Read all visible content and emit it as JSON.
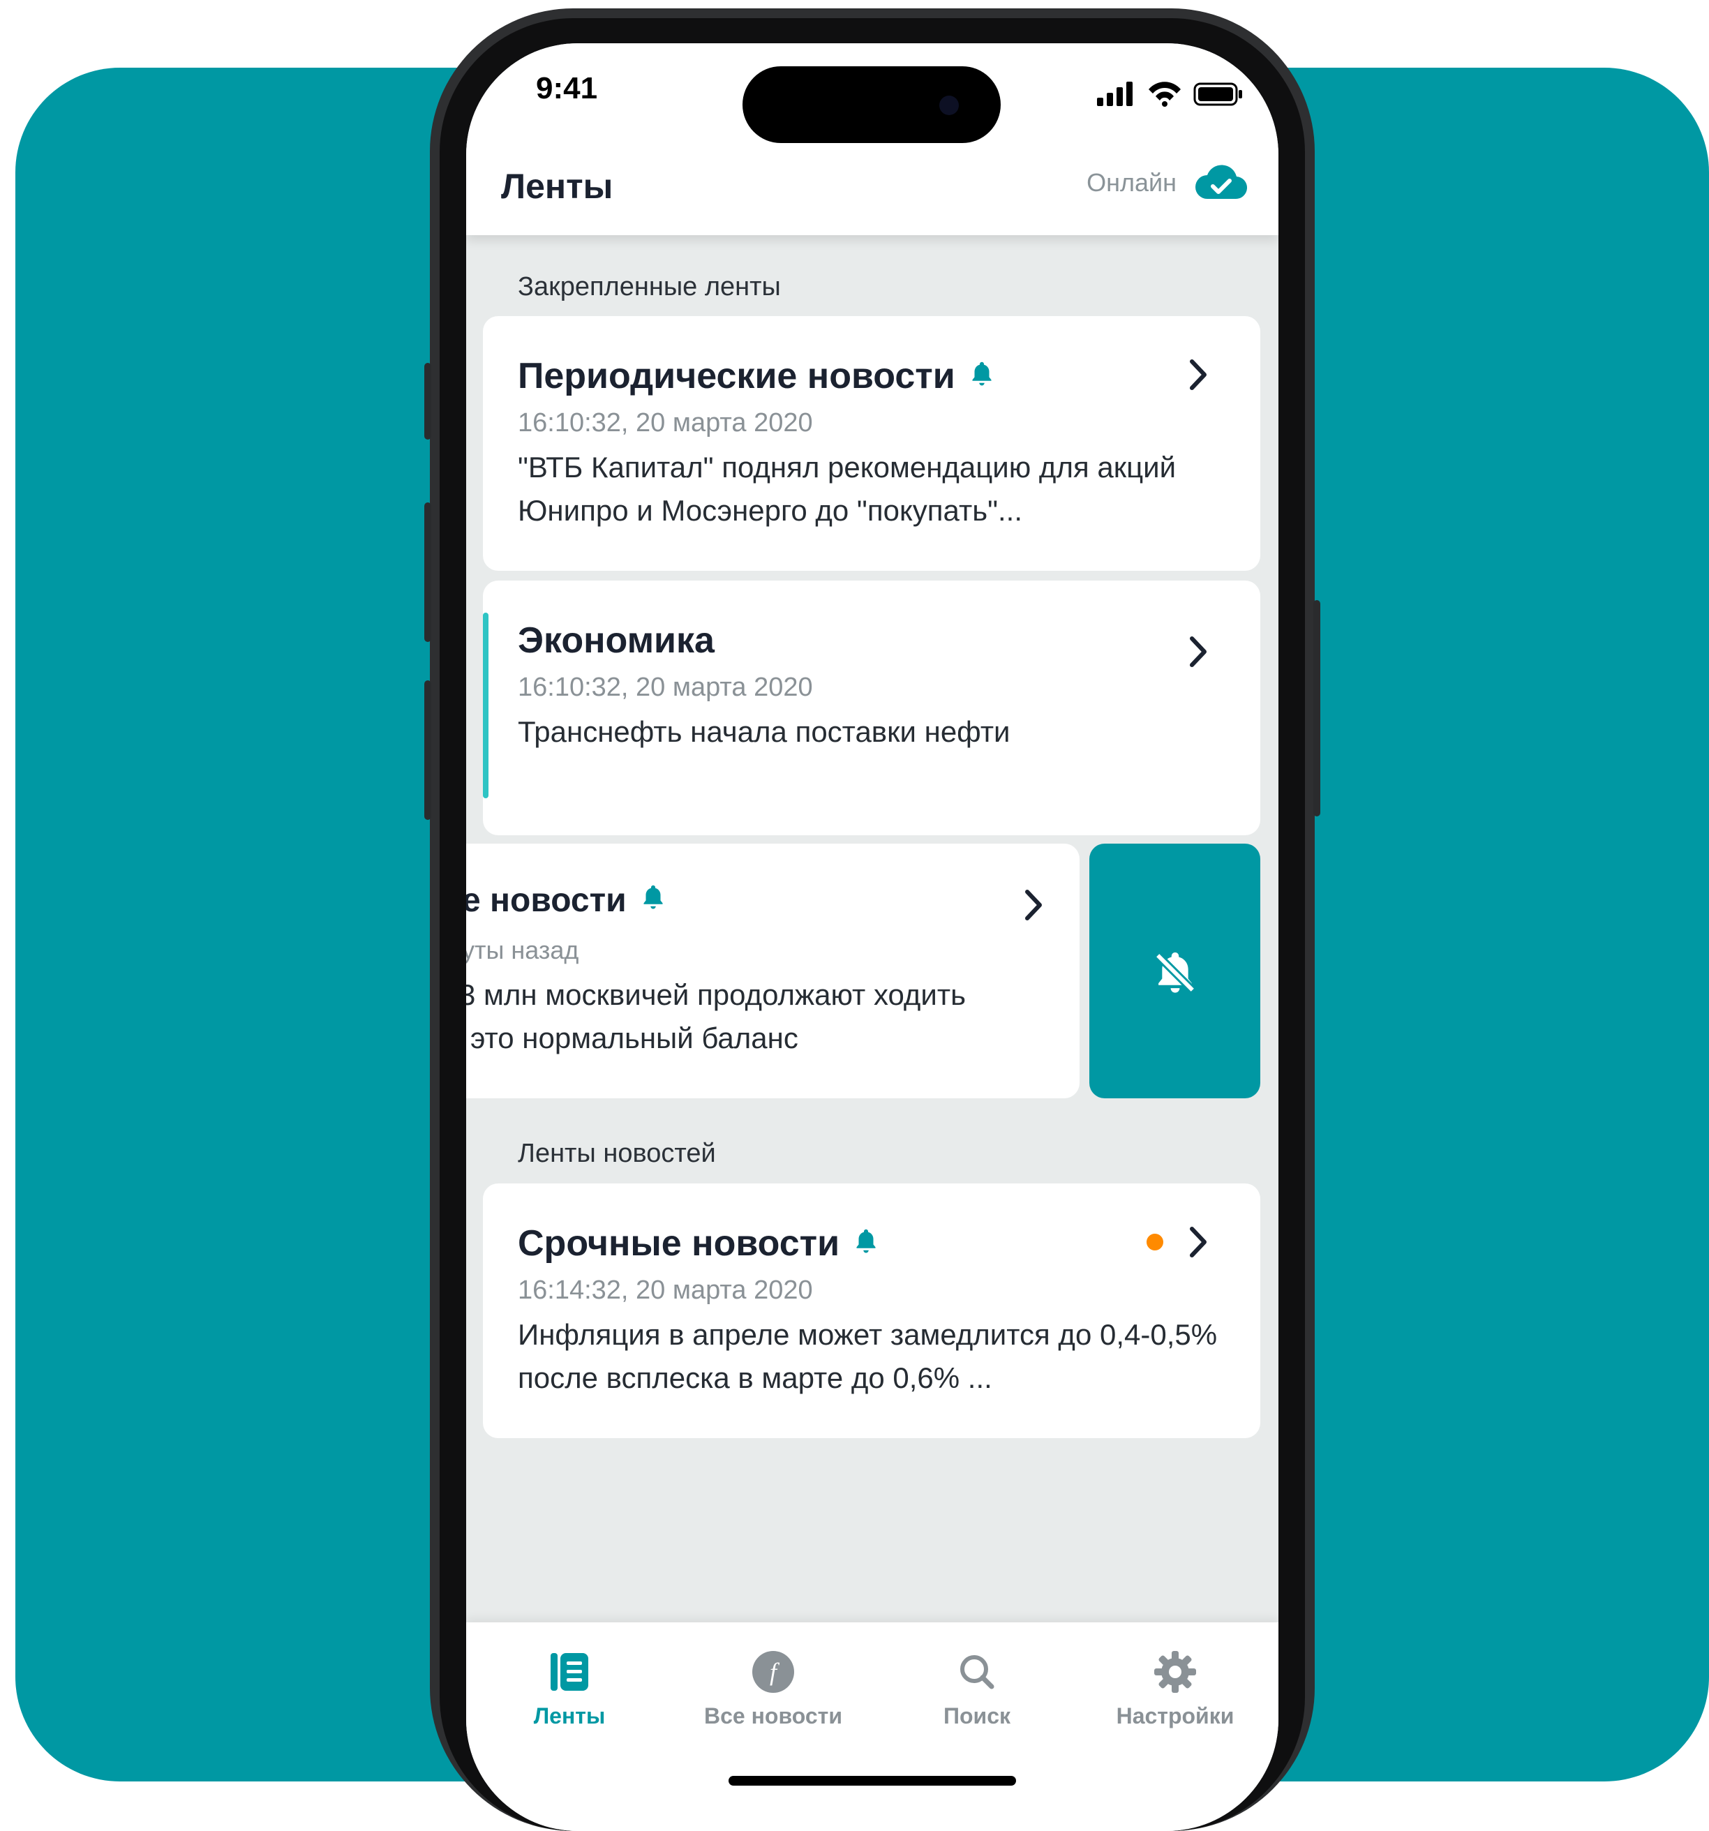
{
  "status": {
    "time": "9:41"
  },
  "header": {
    "title": "Ленты",
    "online_label": "Онлайн"
  },
  "sections": {
    "pinned": "Закрепленные ленты",
    "feeds": "Ленты новостей"
  },
  "cards": {
    "periodic": {
      "title": "Периодические новости",
      "time": "16:10:32, 20 марта 2020",
      "text": "\"ВТБ Капитал\" поднял рекомендацию для акций Юнипро и Мосэнерго до \"покупать\"..."
    },
    "economy": {
      "title": "Экономика",
      "time": "16:10:32, 20 марта 2020",
      "text": "Транснефть начала поставки нефти"
    },
    "swiped": {
      "title": "е новости",
      "time": "уты назад",
      "text_line1": "3 млн москвичей продолжают ходить",
      "text_line2": "это нормальный баланс"
    },
    "urgent": {
      "title": "Срочные новости",
      "time": "16:14:32, 20 марта 2020",
      "text": "Инфляция в апреле может замедлится до 0,4-0,5% после всплеска в марте до 0,6% ..."
    }
  },
  "tabs": [
    {
      "label": "Ленты",
      "icon": "feeds-icon",
      "active": true
    },
    {
      "label": "Все новости",
      "icon": "all-news-icon",
      "active": false
    },
    {
      "label": "Поиск",
      "icon": "search-icon",
      "active": false
    },
    {
      "label": "Настройки",
      "icon": "settings-icon",
      "active": false
    }
  ],
  "colors": {
    "accent": "#0098a3",
    "unread_dot": "#ff8a00",
    "accent_bar": "#2ec4c4"
  }
}
